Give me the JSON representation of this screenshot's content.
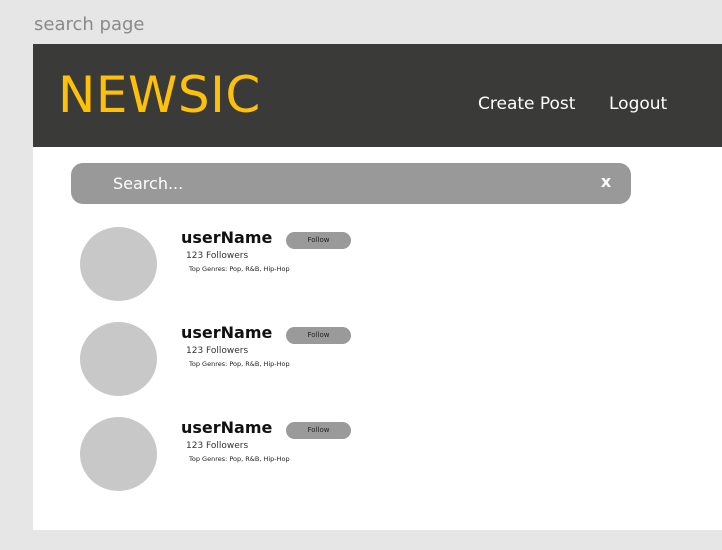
{
  "page_label": "search page",
  "header": {
    "logo": "NEWSIC",
    "nav": {
      "create_post": "Create Post",
      "logout": "Logout"
    }
  },
  "search": {
    "placeholder": "Search...",
    "value": "",
    "clear_glyph": "x"
  },
  "users": [
    {
      "name": "userName",
      "followers": "123 Followers",
      "genres": "Top Genres: Pop, R&B, Hip-Hop",
      "follow_label": "Follow"
    },
    {
      "name": "userName",
      "followers": "123 Followers",
      "genres": "Top Genres: Pop, R&B, Hip-Hop",
      "follow_label": "Follow"
    },
    {
      "name": "userName",
      "followers": "123 Followers",
      "genres": "Top Genres: Pop, R&B, Hip-Hop",
      "follow_label": "Follow"
    }
  ],
  "colors": {
    "brand_yellow": "#ffc107",
    "navbar_bg": "#3a3a38",
    "search_bg": "#999999",
    "avatar_placeholder": "#c8c8c8",
    "follow_button_bg": "#9a9a9a"
  }
}
